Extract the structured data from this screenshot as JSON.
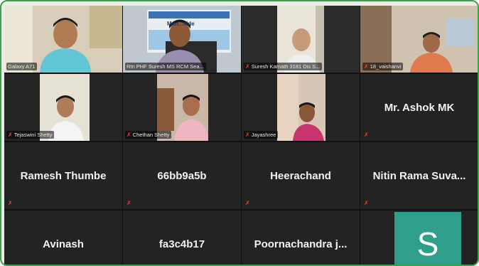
{
  "participants": [
    {
      "label": "Galaxy A71",
      "muted": false
    },
    {
      "label": "Rtn PHF Suresh MS RCM Sea...",
      "muted": false
    },
    {
      "label": "Suresh Kamath 3181 Dis S...",
      "muted": true
    },
    {
      "label": "18_vaishanvi",
      "muted": true
    },
    {
      "label": "Tejaswini Shetty",
      "muted": true
    },
    {
      "label": "Chethan Shetty",
      "muted": true
    },
    {
      "label": "Jayashree",
      "muted": true
    },
    {
      "label": "Mr. Ashok MK",
      "muted": true
    },
    {
      "label": "Ramesh Thumbe",
      "muted": true
    },
    {
      "label": "66bb9a5b",
      "muted": true
    },
    {
      "label": "Heerachand",
      "muted": true
    },
    {
      "label": "Nitin Rama Suva...",
      "muted": true
    },
    {
      "label": "Avinash",
      "muted": false
    },
    {
      "label": "fa3c4b17",
      "muted": false
    },
    {
      "label": "Poornachandra  j...",
      "muted": false
    },
    {
      "label": "S",
      "muted": false
    }
  ],
  "banner_text": "Man...side",
  "mute_symbol": "✗",
  "colors": {
    "frame_border": "#3aa24b",
    "active_speaker": "#d9d42a",
    "avatar_bg": "#2f9e8a",
    "muted": "#ff3b30"
  }
}
